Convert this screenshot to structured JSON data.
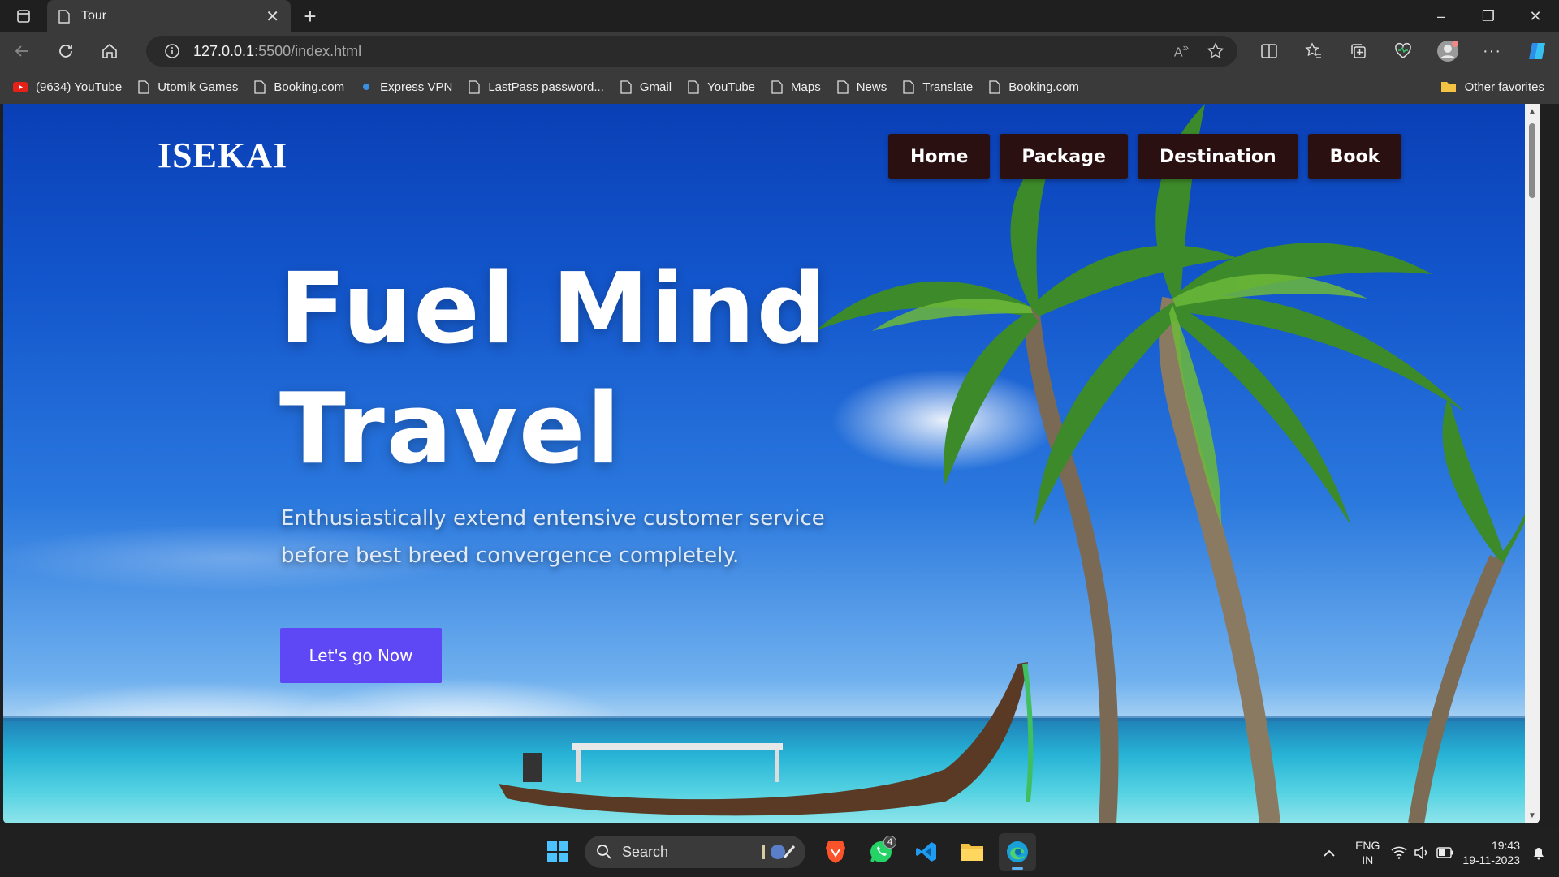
{
  "browser": {
    "tab_title": "Tour",
    "url_host": "127.0.0.1",
    "url_rest": ":5500/index.html",
    "bookmarks": [
      {
        "label": "(9634) YouTube",
        "icon": "youtube-icon"
      },
      {
        "label": "Utomik Games",
        "icon": "page-icon"
      },
      {
        "label": "Booking.com",
        "icon": "page-icon"
      },
      {
        "label": "Express VPN",
        "icon": "vpn-icon"
      },
      {
        "label": "LastPass password...",
        "icon": "page-icon"
      },
      {
        "label": "Gmail",
        "icon": "page-icon"
      },
      {
        "label": "YouTube",
        "icon": "page-icon"
      },
      {
        "label": "Maps",
        "icon": "page-icon"
      },
      {
        "label": "News",
        "icon": "page-icon"
      },
      {
        "label": "Translate",
        "icon": "page-icon"
      },
      {
        "label": "Booking.com",
        "icon": "page-icon"
      }
    ],
    "other_favorites": "Other favorites"
  },
  "site": {
    "logo": "ISEKAI",
    "nav": [
      "Home",
      "Package",
      "Destination",
      "Book"
    ],
    "hero_line1": "Fuel Mind",
    "hero_line2": "Travel",
    "subtitle": "Enthusiastically extend entensive customer service before best breed convergence completely.",
    "cta": "Let's go Now",
    "colors": {
      "cta": "#5e48f5",
      "nav_bg": "#2a1010"
    }
  },
  "taskbar": {
    "search_label": "Search",
    "whatsapp_badge": "4",
    "lang_line1": "ENG",
    "lang_line2": "IN",
    "time": "19:43",
    "date": "19-11-2023"
  }
}
